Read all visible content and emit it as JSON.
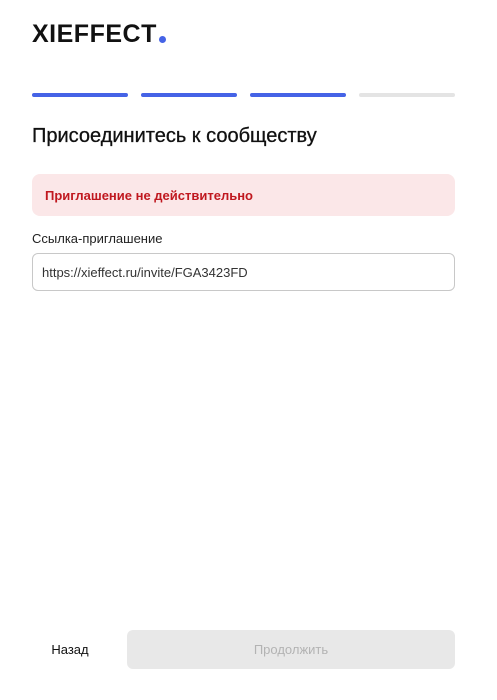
{
  "logo": {
    "text": "XIEFFECT",
    "dot_color": "#4563e6"
  },
  "progress": {
    "total_steps": 4,
    "completed_steps": 3,
    "active_color": "#4563e6",
    "inactive_color": "#e4e4e4"
  },
  "page": {
    "title": "Присоединитесь к сообществу"
  },
  "error": {
    "message": "Приглашение не действительно",
    "text_color": "#c0181f",
    "background": "#fbe7e8"
  },
  "invite_field": {
    "label": "Ссылка-приглашение",
    "value": "https://xieffect.ru/invite/FGA3423FD"
  },
  "footer": {
    "back_label": "Назад",
    "continue_label": "Продолжить",
    "continue_disabled": true,
    "continue_bg": "#e8e8e8",
    "continue_text_color": "#b3b3b3"
  }
}
